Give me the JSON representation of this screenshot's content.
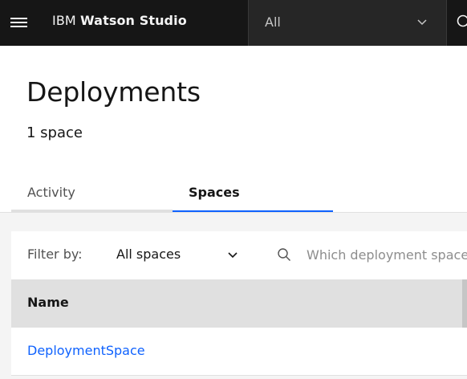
{
  "header": {
    "brand_prefix": "IBM",
    "brand_product": "Watson Studio",
    "context_value": "All"
  },
  "page": {
    "title": "Deployments",
    "subtitle": "1 space"
  },
  "tabs": [
    {
      "label": "Activity",
      "selected": false
    },
    {
      "label": "Spaces",
      "selected": true
    }
  ],
  "toolbar": {
    "filter_label": "Filter by:",
    "filter_value": "All spaces",
    "search_placeholder": "Which deployment space are you looking for?",
    "search_value": ""
  },
  "table": {
    "columns": [
      "Name"
    ],
    "rows": [
      {
        "name": "DeploymentSpace"
      }
    ]
  },
  "colors": {
    "header_bg": "#161616",
    "accent": "#0f62fe",
    "link": "#0f62fe"
  },
  "icons": {
    "menu": "hamburger-menu-icon",
    "context_chevron": "chevron-down-icon",
    "header_search": "search-icon",
    "filter_chevron": "chevron-down-icon",
    "search": "search-icon"
  }
}
